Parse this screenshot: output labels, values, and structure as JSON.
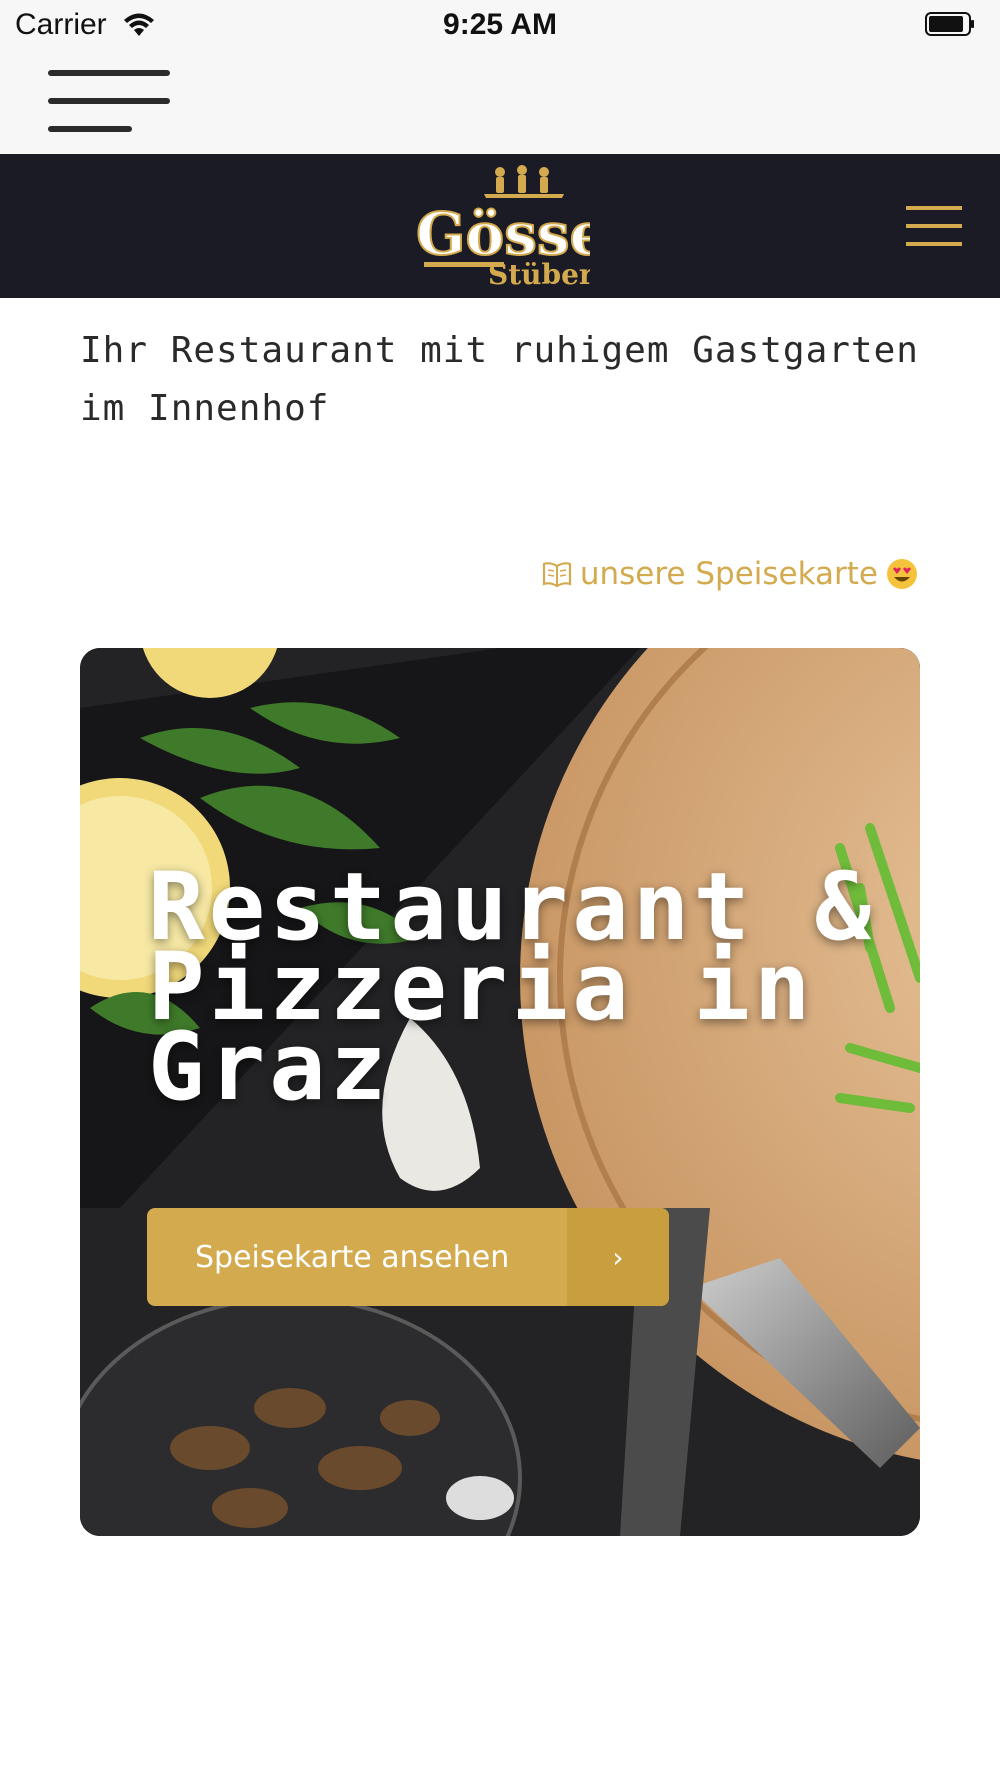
{
  "status_bar": {
    "carrier": "Carrier",
    "time": "9:25 AM",
    "icons": [
      "wifi-icon",
      "battery-icon"
    ]
  },
  "app_bar": {
    "menu_icon": "hamburger-menu-icon"
  },
  "site_header": {
    "logo_text": "Gösser",
    "logo_subtext": "Stüberl",
    "menu_icon": "hamburger-menu-icon",
    "background": "#1b1b26",
    "accent": "#d4aa4e"
  },
  "tagline": "Ihr Restaurant mit ruhigem Gastgarten im Innenhof",
  "menu_link": {
    "label": "unsere Speisekarte",
    "icon_before": "open-book-icon",
    "icon_after": "heart-eyes-emoji-icon"
  },
  "hero": {
    "title": "Restaurant & Pizzeria in Graz",
    "button_label": "Speisekarte ansehen",
    "button_icon": "chevron-right-icon",
    "button_color": "#d4aa4e"
  }
}
